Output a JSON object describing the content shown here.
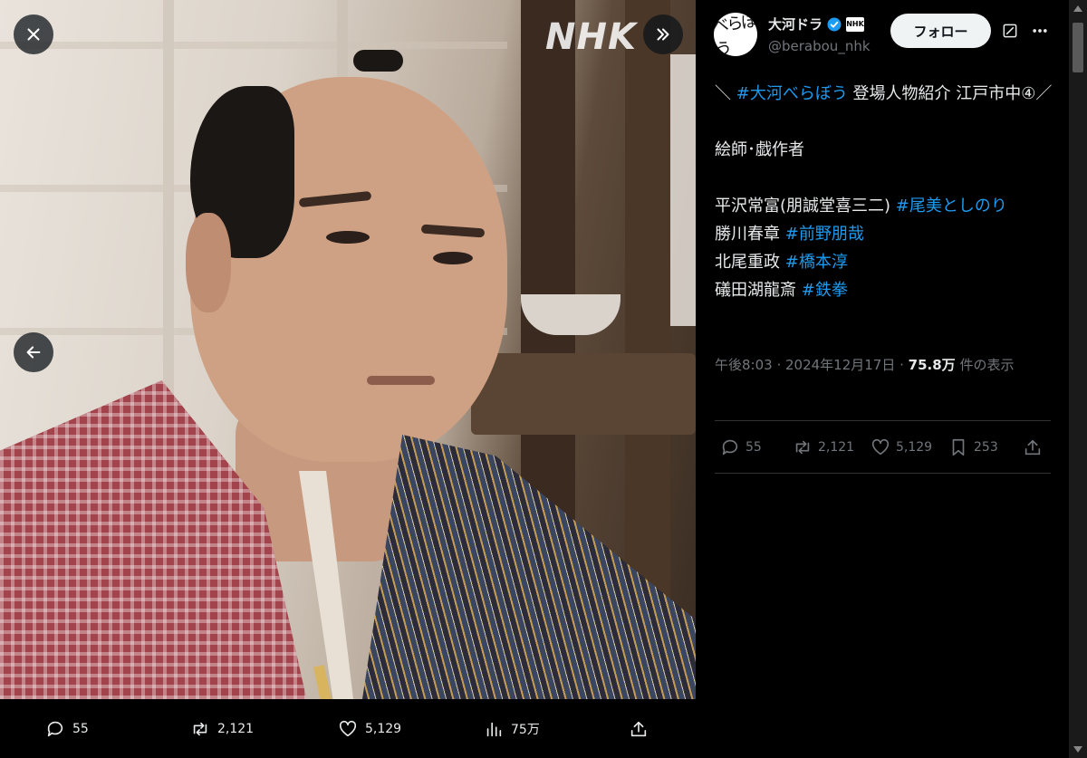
{
  "viewer": {
    "watermark": "NHK",
    "actions": {
      "replies": "55",
      "retweets": "2,121",
      "likes": "5,129",
      "views": "75万"
    }
  },
  "account": {
    "display_name": "大河ドラ",
    "handle": "@berabou_nhk",
    "avatar_text": "べらぼう",
    "org_badge": "NHK",
    "follow_label": "フォロー"
  },
  "tweet": {
    "lines": [
      {
        "parts": [
          {
            "text": "＼ ",
            "tag": false
          },
          {
            "text": "#大河べらぼう",
            "tag": true
          },
          {
            "text": " 登場人物紹介 江戸市中④／",
            "tag": false
          }
        ]
      },
      {
        "parts": []
      },
      {
        "parts": [
          {
            "text": "絵師･戯作者",
            "tag": false
          }
        ]
      },
      {
        "parts": []
      },
      {
        "parts": [
          {
            "text": "平沢常富(朋誠堂喜三二) ",
            "tag": false
          },
          {
            "text": "#尾美としのり",
            "tag": true
          }
        ]
      },
      {
        "parts": [
          {
            "text": "勝川春章 ",
            "tag": false
          },
          {
            "text": "#前野朋哉",
            "tag": true
          }
        ]
      },
      {
        "parts": [
          {
            "text": "北尾重政 ",
            "tag": false
          },
          {
            "text": "#橋本淳",
            "tag": true
          }
        ]
      },
      {
        "parts": [
          {
            "text": "礒田湖龍斎 ",
            "tag": false
          },
          {
            "text": "#鉄拳",
            "tag": true
          }
        ]
      }
    ],
    "time": "午後8:03",
    "date": "2024年12月17日",
    "views_count": "75.8万",
    "views_suffix": " 件の表示"
  },
  "stats": {
    "replies": "55",
    "retweets": "2,121",
    "likes": "5,129",
    "bookmarks": "253"
  },
  "colors": {
    "link": "#1d9bf0",
    "muted": "#71767b",
    "text": "#e7e9ea",
    "background": "#000000"
  },
  "icons": [
    "close-icon",
    "forward-icon",
    "back-arrow-icon",
    "reply-icon",
    "retweet-icon",
    "like-icon",
    "views-icon",
    "share-icon",
    "bookmark-icon",
    "grok-icon",
    "more-icon",
    "verified-icon"
  ]
}
